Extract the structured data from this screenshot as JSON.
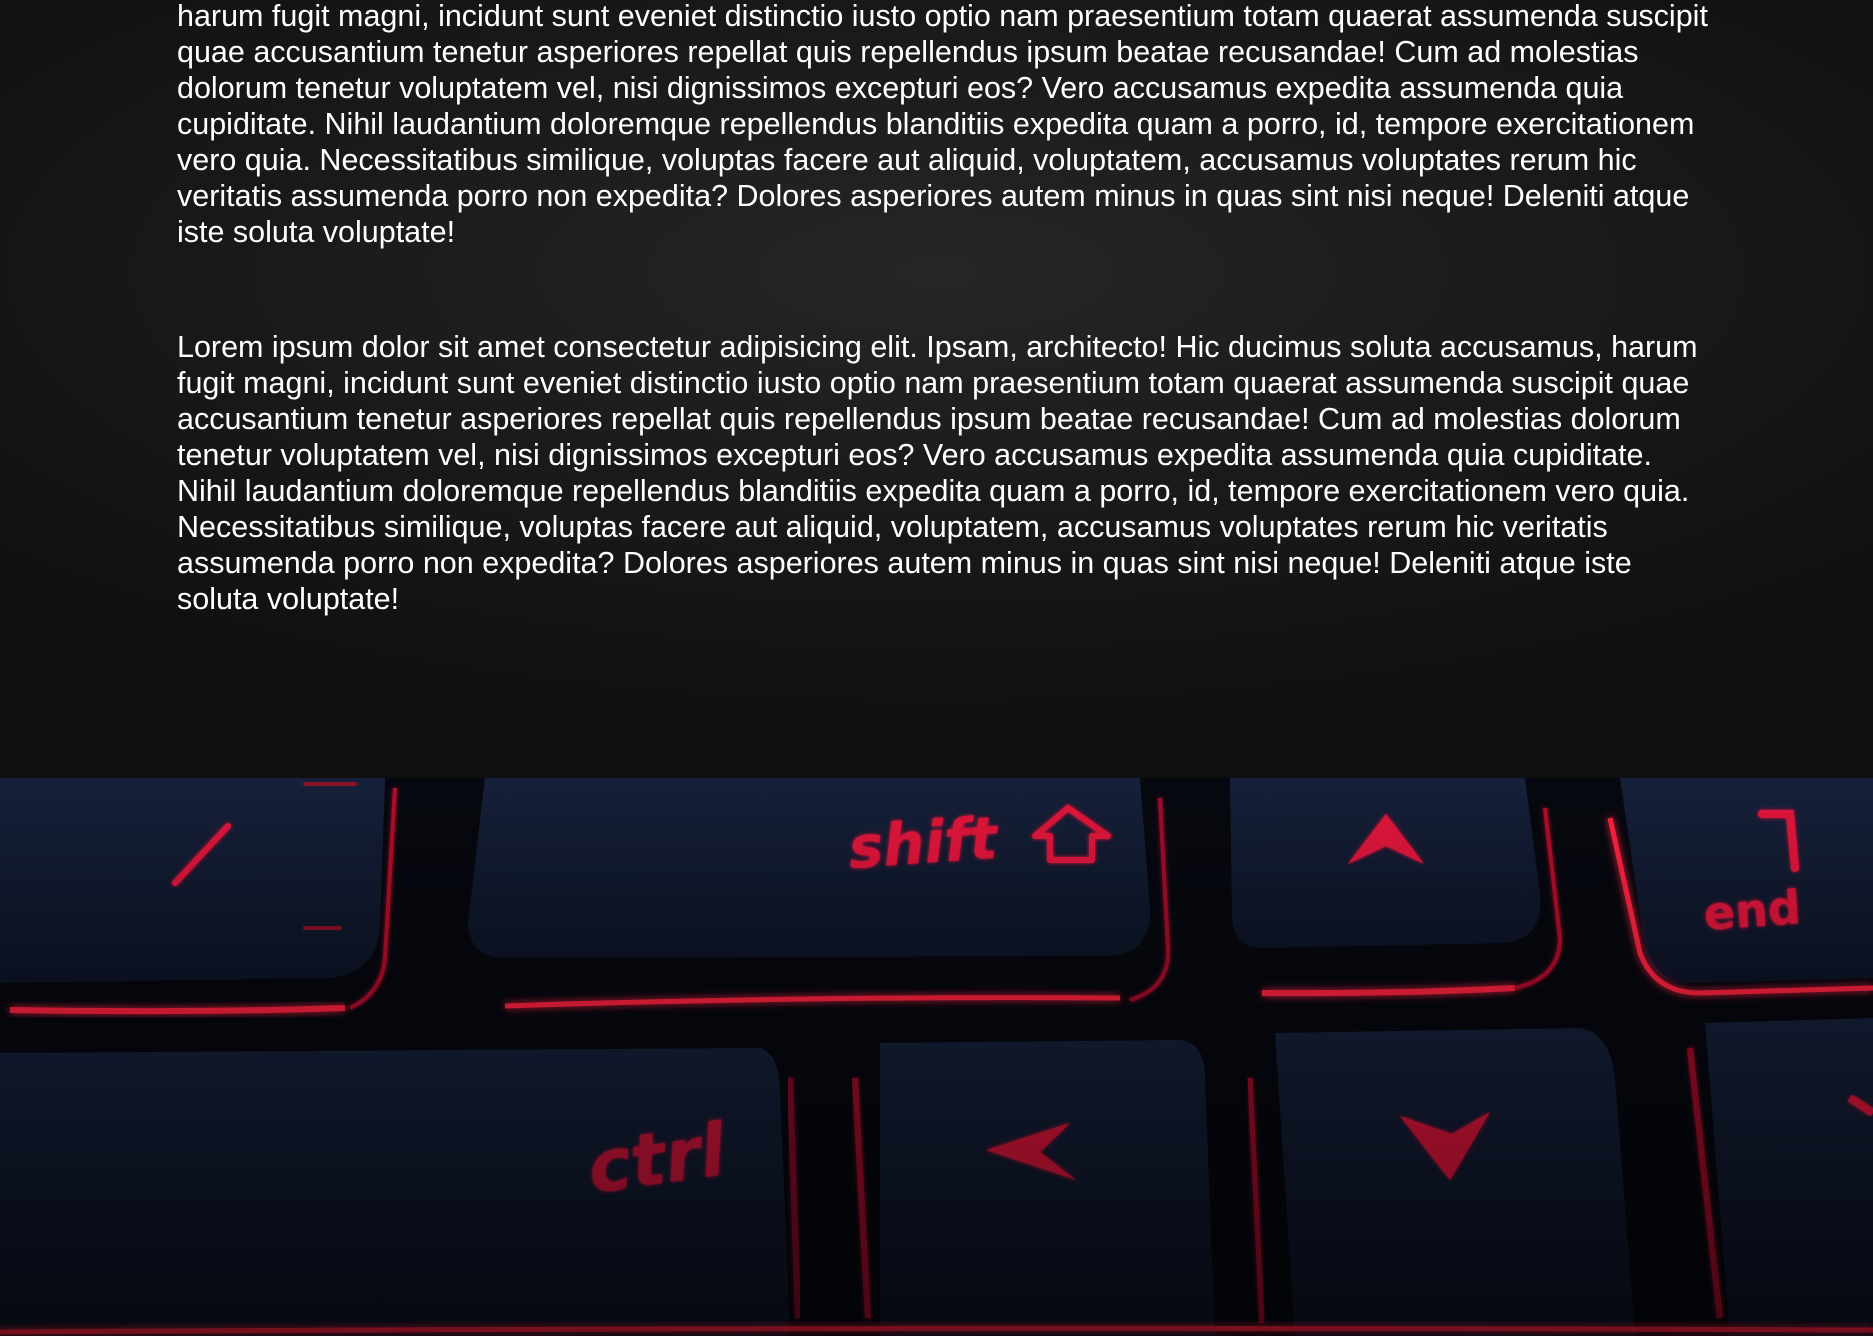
{
  "content": {
    "paragraphs": [
      "harum fugit magni, incidunt sunt eveniet distinctio iusto optio nam praesentium totam quaerat assumenda suscipit quae accusantium tenetur asperiores repellat quis repellendus ipsum beatae recusandae! Cum ad molestias dolorum tenetur voluptatem vel, nisi dignissimos excepturi eos? Vero accusamus expedita assumenda quia cupiditate. Nihil laudantium doloremque repellendus blanditiis expedita quam a porro, id, tempore exercitationem vero quia. Necessitatibus similique, voluptas facere aut aliquid, voluptatem, accusamus voluptates rerum hic veritatis assumenda porro non expedita? Dolores asperiores autem minus in quas sint nisi neque! Deleniti atque iste soluta voluptate!",
      "Lorem ipsum dolor sit amet consectetur adipisicing elit. Ipsam, architecto! Hic ducimus soluta accusamus, harum fugit magni, incidunt sunt eveniet distinctio iusto optio nam praesentium totam quaerat assumenda suscipit quae accusantium tenetur asperiores repellat quis repellendus ipsum beatae recusandae! Cum ad molestias dolorum tenetur voluptatem vel, nisi dignissimos excepturi eos? Vero accusamus expedita assumenda quia cupiditate. Nihil laudantium doloremque repellendus blanditiis expedita quam a porro, id, tempore exercitationem vero quia. Necessitatibus similique, voluptas facere aut aliquid, voluptatem, accusamus voluptates rerum hic veritatis assumenda porro non expedita? Dolores asperiores autem minus in quas sint nisi neque! Deleniti atque iste soluta voluptate!"
    ]
  },
  "hero_image": {
    "keys": {
      "shift": "shift",
      "ctrl": "ctrl",
      "end": "end"
    },
    "colors": {
      "key_glow": "#ff1a3a",
      "key_surface": "#121a30",
      "background": "#0a0f1e"
    }
  }
}
